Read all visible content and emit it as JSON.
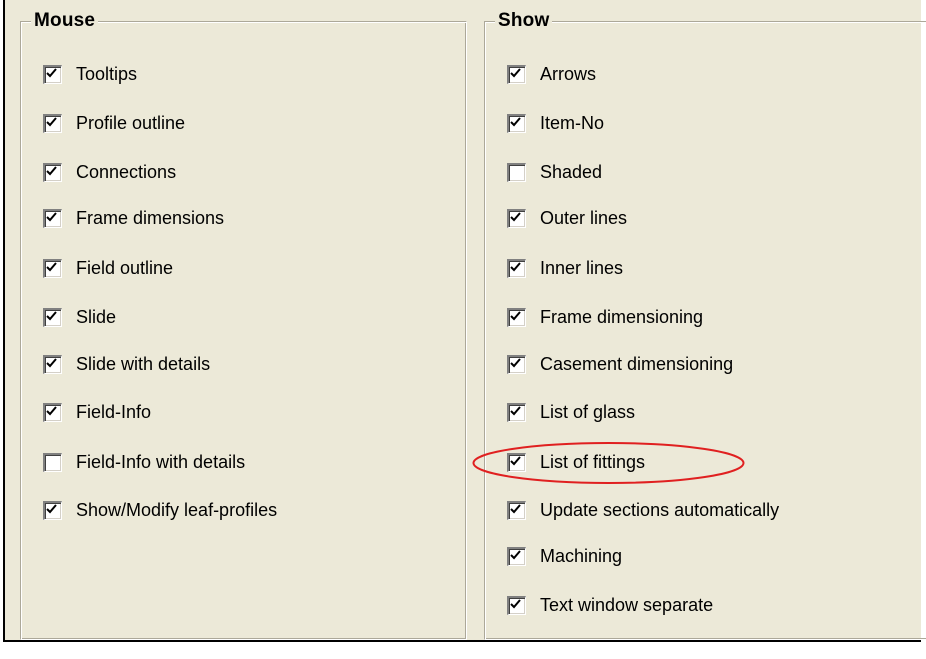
{
  "mouse": {
    "title": "Mouse",
    "items": [
      {
        "label": "Tooltips",
        "checked": true
      },
      {
        "label": "Profile outline",
        "checked": true
      },
      {
        "label": "Connections",
        "checked": true
      },
      {
        "label": "Frame dimensions",
        "checked": true
      },
      {
        "label": "Field outline",
        "checked": true
      },
      {
        "label": "Slide",
        "checked": true
      },
      {
        "label": "Slide with details",
        "checked": true
      },
      {
        "label": "Field-Info",
        "checked": true
      },
      {
        "label": "Field-Info with details",
        "checked": false
      },
      {
        "label": "Show/Modify leaf-profiles",
        "checked": true
      }
    ]
  },
  "show": {
    "title": "Show",
    "items": [
      {
        "label": "Arrows",
        "checked": true
      },
      {
        "label": "Item-No",
        "checked": true
      },
      {
        "label": "Shaded",
        "checked": false
      },
      {
        "label": "Outer lines",
        "checked": true
      },
      {
        "label": "Inner lines",
        "checked": true
      },
      {
        "label": "Frame dimensioning",
        "checked": true
      },
      {
        "label": "Casement dimensioning",
        "checked": true
      },
      {
        "label": "List of glass",
        "checked": true
      },
      {
        "label": "List of fittings",
        "checked": true
      },
      {
        "label": "Update sections automatically",
        "checked": true
      },
      {
        "label": "Machining",
        "checked": true
      },
      {
        "label": "Text window separate",
        "checked": true
      }
    ]
  },
  "annotation": {
    "highlighted_item": "List of fittings",
    "color": "#e02020"
  },
  "colors": {
    "dialog_bg": "#ece9d8",
    "checkbox_bg": "#ffffff",
    "group_border_dark": "#aca899"
  }
}
